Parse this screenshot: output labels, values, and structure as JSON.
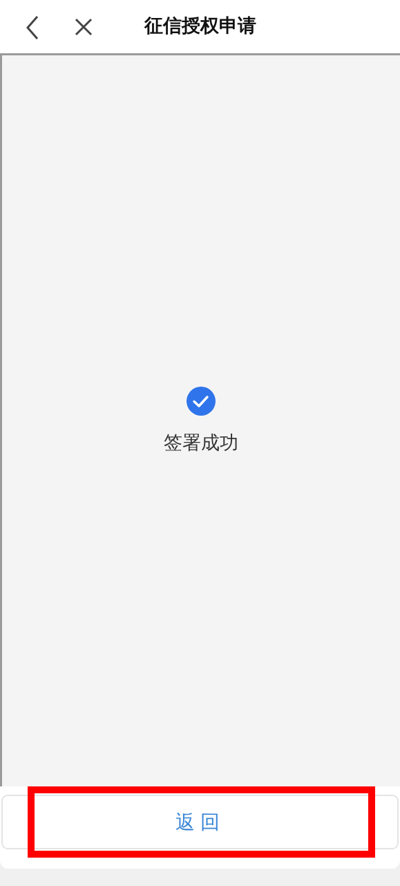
{
  "header": {
    "title": "征信授权申请"
  },
  "result": {
    "message": "签署成功"
  },
  "footer": {
    "button": "返回",
    "highlighted": true
  }
}
